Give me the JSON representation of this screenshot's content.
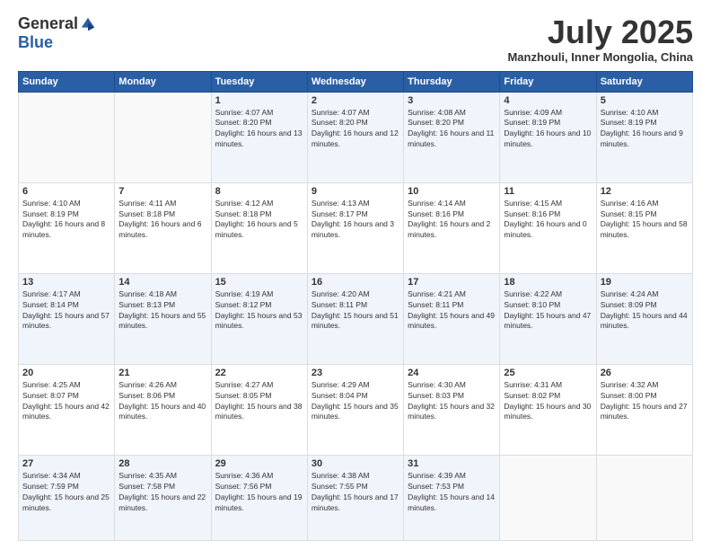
{
  "header": {
    "logo_general": "General",
    "logo_blue": "Blue",
    "title": "July 2025",
    "location": "Manzhouli, Inner Mongolia, China"
  },
  "days_of_week": [
    "Sunday",
    "Monday",
    "Tuesday",
    "Wednesday",
    "Thursday",
    "Friday",
    "Saturday"
  ],
  "weeks": [
    [
      {
        "day": "",
        "info": ""
      },
      {
        "day": "",
        "info": ""
      },
      {
        "day": "1",
        "info": "Sunrise: 4:07 AM\nSunset: 8:20 PM\nDaylight: 16 hours and 13 minutes."
      },
      {
        "day": "2",
        "info": "Sunrise: 4:07 AM\nSunset: 8:20 PM\nDaylight: 16 hours and 12 minutes."
      },
      {
        "day": "3",
        "info": "Sunrise: 4:08 AM\nSunset: 8:20 PM\nDaylight: 16 hours and 11 minutes."
      },
      {
        "day": "4",
        "info": "Sunrise: 4:09 AM\nSunset: 8:19 PM\nDaylight: 16 hours and 10 minutes."
      },
      {
        "day": "5",
        "info": "Sunrise: 4:10 AM\nSunset: 8:19 PM\nDaylight: 16 hours and 9 minutes."
      }
    ],
    [
      {
        "day": "6",
        "info": "Sunrise: 4:10 AM\nSunset: 8:19 PM\nDaylight: 16 hours and 8 minutes."
      },
      {
        "day": "7",
        "info": "Sunrise: 4:11 AM\nSunset: 8:18 PM\nDaylight: 16 hours and 6 minutes."
      },
      {
        "day": "8",
        "info": "Sunrise: 4:12 AM\nSunset: 8:18 PM\nDaylight: 16 hours and 5 minutes."
      },
      {
        "day": "9",
        "info": "Sunrise: 4:13 AM\nSunset: 8:17 PM\nDaylight: 16 hours and 3 minutes."
      },
      {
        "day": "10",
        "info": "Sunrise: 4:14 AM\nSunset: 8:16 PM\nDaylight: 16 hours and 2 minutes."
      },
      {
        "day": "11",
        "info": "Sunrise: 4:15 AM\nSunset: 8:16 PM\nDaylight: 16 hours and 0 minutes."
      },
      {
        "day": "12",
        "info": "Sunrise: 4:16 AM\nSunset: 8:15 PM\nDaylight: 15 hours and 58 minutes."
      }
    ],
    [
      {
        "day": "13",
        "info": "Sunrise: 4:17 AM\nSunset: 8:14 PM\nDaylight: 15 hours and 57 minutes."
      },
      {
        "day": "14",
        "info": "Sunrise: 4:18 AM\nSunset: 8:13 PM\nDaylight: 15 hours and 55 minutes."
      },
      {
        "day": "15",
        "info": "Sunrise: 4:19 AM\nSunset: 8:12 PM\nDaylight: 15 hours and 53 minutes."
      },
      {
        "day": "16",
        "info": "Sunrise: 4:20 AM\nSunset: 8:11 PM\nDaylight: 15 hours and 51 minutes."
      },
      {
        "day": "17",
        "info": "Sunrise: 4:21 AM\nSunset: 8:11 PM\nDaylight: 15 hours and 49 minutes."
      },
      {
        "day": "18",
        "info": "Sunrise: 4:22 AM\nSunset: 8:10 PM\nDaylight: 15 hours and 47 minutes."
      },
      {
        "day": "19",
        "info": "Sunrise: 4:24 AM\nSunset: 8:09 PM\nDaylight: 15 hours and 44 minutes."
      }
    ],
    [
      {
        "day": "20",
        "info": "Sunrise: 4:25 AM\nSunset: 8:07 PM\nDaylight: 15 hours and 42 minutes."
      },
      {
        "day": "21",
        "info": "Sunrise: 4:26 AM\nSunset: 8:06 PM\nDaylight: 15 hours and 40 minutes."
      },
      {
        "day": "22",
        "info": "Sunrise: 4:27 AM\nSunset: 8:05 PM\nDaylight: 15 hours and 38 minutes."
      },
      {
        "day": "23",
        "info": "Sunrise: 4:29 AM\nSunset: 8:04 PM\nDaylight: 15 hours and 35 minutes."
      },
      {
        "day": "24",
        "info": "Sunrise: 4:30 AM\nSunset: 8:03 PM\nDaylight: 15 hours and 32 minutes."
      },
      {
        "day": "25",
        "info": "Sunrise: 4:31 AM\nSunset: 8:02 PM\nDaylight: 15 hours and 30 minutes."
      },
      {
        "day": "26",
        "info": "Sunrise: 4:32 AM\nSunset: 8:00 PM\nDaylight: 15 hours and 27 minutes."
      }
    ],
    [
      {
        "day": "27",
        "info": "Sunrise: 4:34 AM\nSunset: 7:59 PM\nDaylight: 15 hours and 25 minutes."
      },
      {
        "day": "28",
        "info": "Sunrise: 4:35 AM\nSunset: 7:58 PM\nDaylight: 15 hours and 22 minutes."
      },
      {
        "day": "29",
        "info": "Sunrise: 4:36 AM\nSunset: 7:56 PM\nDaylight: 15 hours and 19 minutes."
      },
      {
        "day": "30",
        "info": "Sunrise: 4:38 AM\nSunset: 7:55 PM\nDaylight: 15 hours and 17 minutes."
      },
      {
        "day": "31",
        "info": "Sunrise: 4:39 AM\nSunset: 7:53 PM\nDaylight: 15 hours and 14 minutes."
      },
      {
        "day": "",
        "info": ""
      },
      {
        "day": "",
        "info": ""
      }
    ]
  ]
}
